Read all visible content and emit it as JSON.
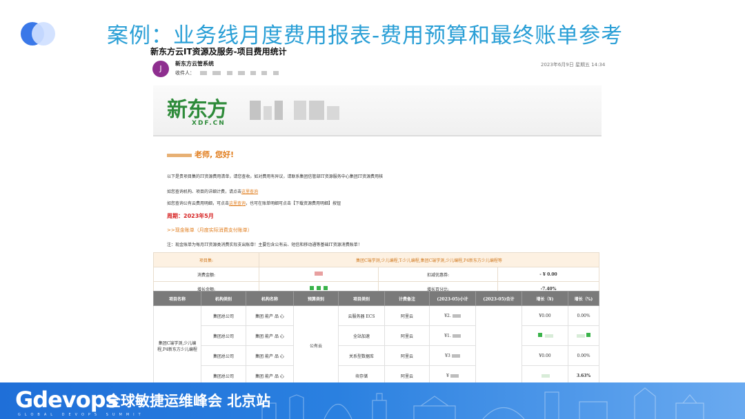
{
  "slide": {
    "title": "案例：业务线月度费用报表-费用预算和最终账单参考"
  },
  "email": {
    "subject": "新东方云IT资源及服务-项目费用统计",
    "avatar_letter": "J",
    "sender": "新东方云管系统",
    "recipient_label": "收件人：",
    "time": "2023年6月9日 星期五 14:34"
  },
  "banner": {
    "brand_cn": "新东方",
    "brand_en": "XDF.CN"
  },
  "body": {
    "greeting": "老师, 您好!",
    "line1": "以下是贵项目集的IT资源费用清单，请您查收。如对费用有异议，请联系集团信管部IT资源服务中心集团IT资源费用核",
    "line2_prefix": "如您查询机构、项目的详细计费，请点击",
    "line2_link": "这里查询",
    "line3_prefix": "如您查询公有云费用明细，可点击",
    "line3_link": "这里查询",
    "line3_suffix": "，也可在账单明细可点击【下载资源费用明细】按钮",
    "period": "周期：2023年5月",
    "bill_title": ">>现金账单（月度实际消费支付账单）",
    "note": "注：现金账单为每月IT资源类消费实际支出账单！主要包含公有云、短信和移动通等基础IT资源消费账单！"
  },
  "summary": {
    "project_label": "项目集:",
    "project_value": "集团C端学测,少儿编程,T-少儿编程,集团C端学测,少儿编程,P4新东方少儿编程等",
    "spend_label": "消费金额:",
    "discount_label": "扣减优惠券:",
    "discount_value": "- ¥ 0.00",
    "growth_label": "增长金额:",
    "growth_pct_label": "增长百分比:",
    "growth_pct_value": "-7.40%"
  },
  "detail": {
    "headers": [
      "项目名称",
      "机构类别",
      "机构名称",
      "预算类别",
      "项目类别",
      "计费备注",
      "(2023-05)小计",
      "(2023-05)合计",
      "增长（¥)",
      "增长（%)"
    ],
    "project_name": "集团C端学测,少儿编程,P4新东方少儿编程",
    "budget_type": "公有云",
    "rows": [
      {
        "org_type": "集团总公司",
        "org_name": "集团 能产 品 心",
        "category": "云服务器 ECS",
        "note": "阿里云",
        "subtotal": "¥2.",
        "growth_amt": "¥0.00",
        "growth_pct": "0.00%"
      },
      {
        "org_type": "集团总公司",
        "org_name": "集团 能产 品 心",
        "category": "全站加速",
        "note": "阿里云",
        "subtotal": "¥1.",
        "growth_amt": "",
        "growth_pct": ""
      },
      {
        "org_type": "集团总公司",
        "org_name": "集团 能产 品 心",
        "category": "关系型数据库",
        "note": "阿里云",
        "subtotal": "¥3",
        "growth_amt": "¥0.00",
        "growth_pct": "0.00%"
      },
      {
        "org_type": "集团总公司",
        "org_name": "集团 能产 品 心",
        "category": "块存储",
        "note": "阿里云",
        "subtotal": "¥",
        "growth_amt": "",
        "growth_pct": "3.63%"
      }
    ]
  },
  "footer": {
    "brand": "Gdevops",
    "subtitle": "全球敏捷运维峰会 北京站",
    "tagline": "GLOBAL DEVOPS SUMMIT"
  }
}
